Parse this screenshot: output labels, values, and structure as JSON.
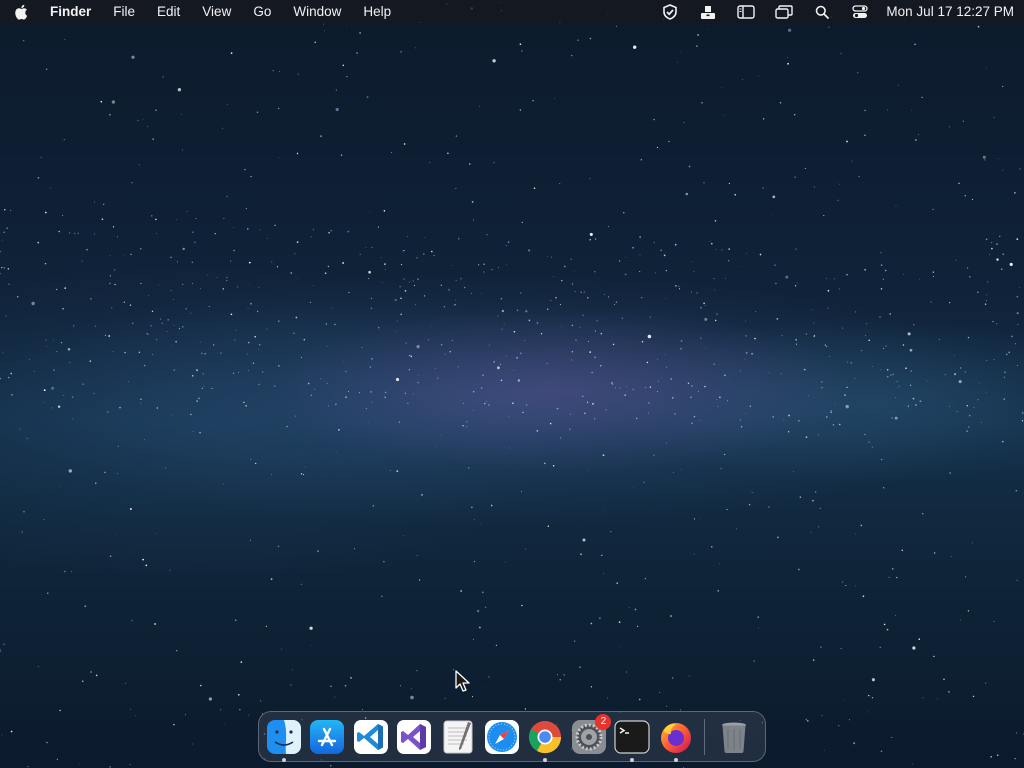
{
  "menubar": {
    "apple_icon": "apple-logo",
    "app_name": "Finder",
    "menus": [
      "File",
      "Edit",
      "View",
      "Go",
      "Window",
      "Help"
    ],
    "status_icons": [
      "shield-check-icon",
      "upload-tray-icon",
      "sidebar-icon",
      "window-stack-icon",
      "search-icon",
      "control-center-icon"
    ],
    "clock": "Mon Jul 17  12:27 PM"
  },
  "dock": {
    "apps": [
      {
        "name": "Finder",
        "icon": "finder-icon",
        "running": true
      },
      {
        "name": "App Store",
        "icon": "app-store-icon",
        "running": false
      },
      {
        "name": "Visual Studio Code",
        "icon": "vscode-icon",
        "running": false
      },
      {
        "name": "Visual Studio",
        "icon": "visual-studio-icon",
        "running": false
      },
      {
        "name": "TextEdit",
        "icon": "textedit-icon",
        "running": false
      },
      {
        "name": "Safari",
        "icon": "safari-icon",
        "running": false
      },
      {
        "name": "Google Chrome",
        "icon": "chrome-icon",
        "running": true
      },
      {
        "name": "System Settings",
        "icon": "settings-gear-icon",
        "running": false,
        "badge": "2"
      },
      {
        "name": "Terminal",
        "icon": "terminal-icon",
        "running": true
      },
      {
        "name": "Firefox",
        "icon": "firefox-icon",
        "running": true
      }
    ],
    "trash": {
      "name": "Trash",
      "icon": "trash-icon"
    }
  },
  "colors": {
    "menubar_bg": "#16181e",
    "badge_red": "#e8322b",
    "sky_dark": "#0c1a2b"
  }
}
